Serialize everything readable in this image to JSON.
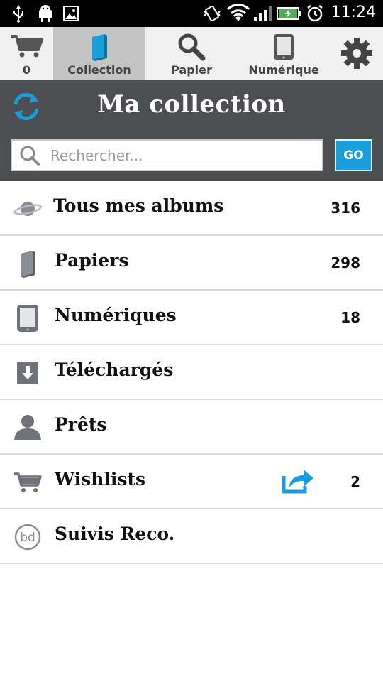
{
  "status_bar": {
    "time": "11:24",
    "icons": [
      "usb-icon",
      "android-debug-icon",
      "image-icon",
      "vibrate-icon",
      "wifi-icon",
      "signal-icon",
      "battery-icon",
      "alarm-icon"
    ]
  },
  "tabs": [
    {
      "label": "0",
      "icon": "cart-icon"
    },
    {
      "label": "Collection",
      "icon": "book-icon"
    },
    {
      "label": "Papier",
      "icon": "search-icon"
    },
    {
      "label": "Numérique",
      "icon": "tablet-icon"
    },
    {
      "label": "",
      "icon": "gear-icon"
    }
  ],
  "header": {
    "title": "Ma collection"
  },
  "search": {
    "placeholder": "Rechercher...",
    "value": "",
    "go_label": "GO"
  },
  "list": [
    {
      "label": "Tous mes albums",
      "count": "316",
      "icon": "planet-icon"
    },
    {
      "label": "Papiers",
      "count": "298",
      "icon": "book-icon"
    },
    {
      "label": "Numériques",
      "count": "18",
      "icon": "tablet-icon"
    },
    {
      "label": "Téléchargés",
      "count": "",
      "icon": "download-icon"
    },
    {
      "label": "Prêts",
      "count": "",
      "icon": "person-icon"
    },
    {
      "label": "Wishlists",
      "count": "2",
      "icon": "cart-icon"
    },
    {
      "label": "Suivis Reco.",
      "count": "",
      "icon": "bd-logo-icon"
    }
  ],
  "colors": {
    "accent": "#1a9edb",
    "header_bg": "#4d4e52",
    "tab_active": "#c4c4c4"
  }
}
